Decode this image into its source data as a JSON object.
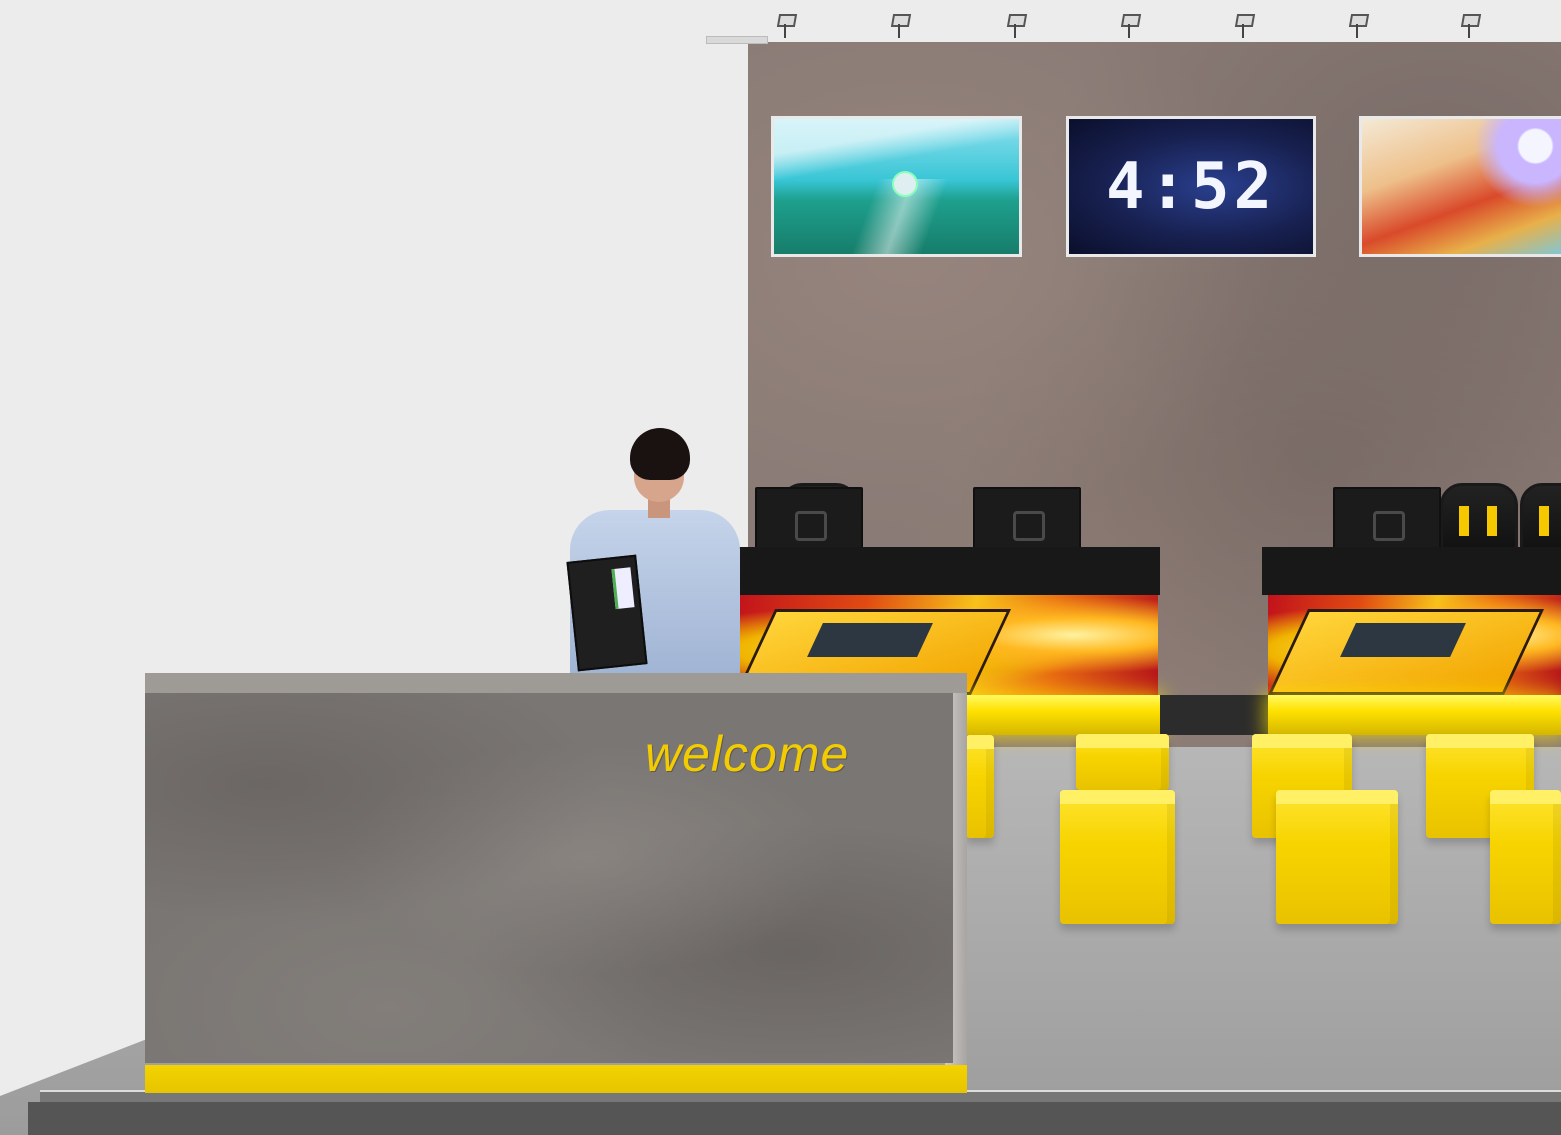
{
  "scene": {
    "title": "",
    "wall_screens": [
      {
        "name": "rocket-league-gameplay-screen",
        "text": ""
      },
      {
        "name": "countdown-timer-screen",
        "text": "4:52"
      },
      {
        "name": "rocket-league-promo-screen",
        "text": ""
      }
    ],
    "reception_counter": {
      "sign_text": "welcome",
      "sign_color": "#f2cc00"
    },
    "accent_color": "#f7d400",
    "wall_color": "#8a7b76"
  }
}
